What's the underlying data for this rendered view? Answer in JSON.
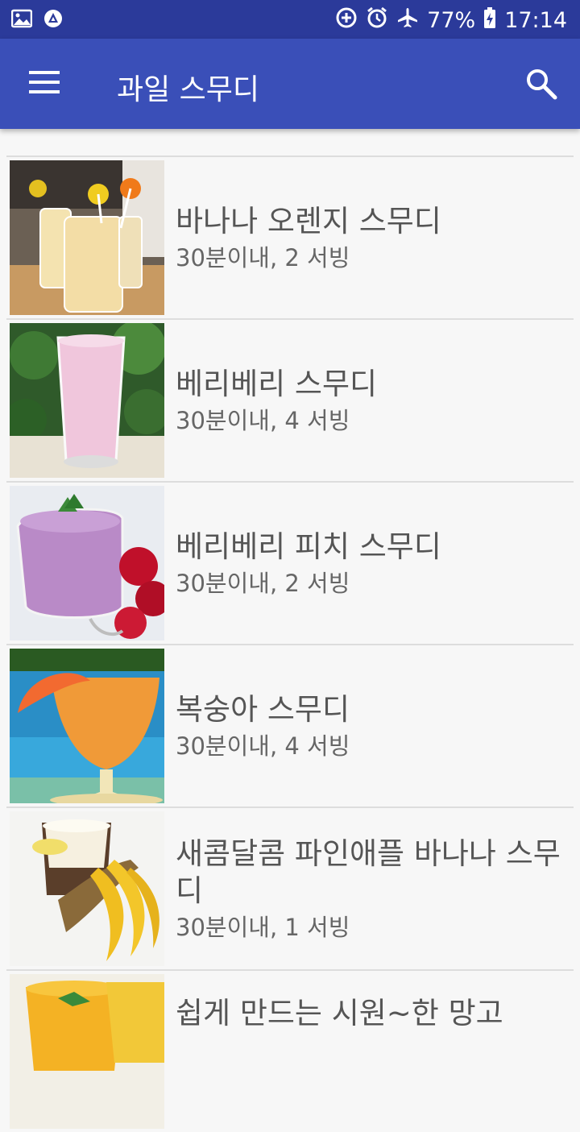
{
  "status_bar": {
    "battery": "77%",
    "time": "17:14",
    "icons": [
      "image-icon",
      "app-notification-icon",
      "data-saver-icon",
      "alarm-icon",
      "airplane-mode-icon",
      "battery-charging-icon"
    ]
  },
  "app_bar": {
    "title": "과일 스무디",
    "menu_icon": "hamburger-menu-icon",
    "search_icon": "search-icon"
  },
  "recipes": [
    {
      "name": "바나나 오렌지 스무디",
      "meta": "30분이내, 2 서빙"
    },
    {
      "name": "베리베리 스무디",
      "meta": "30분이내, 4 서빙"
    },
    {
      "name": "베리베리 피치 스무디",
      "meta": "30분이내, 2 서빙"
    },
    {
      "name": "복숭아 스무디",
      "meta": "30분이내, 4 서빙"
    },
    {
      "name": "새콤달콤 파인애플 바나나 스무디",
      "meta": "30분이내, 1 서빙"
    },
    {
      "name": "쉽게 만드는 시원~한 망고",
      "meta": ""
    }
  ]
}
